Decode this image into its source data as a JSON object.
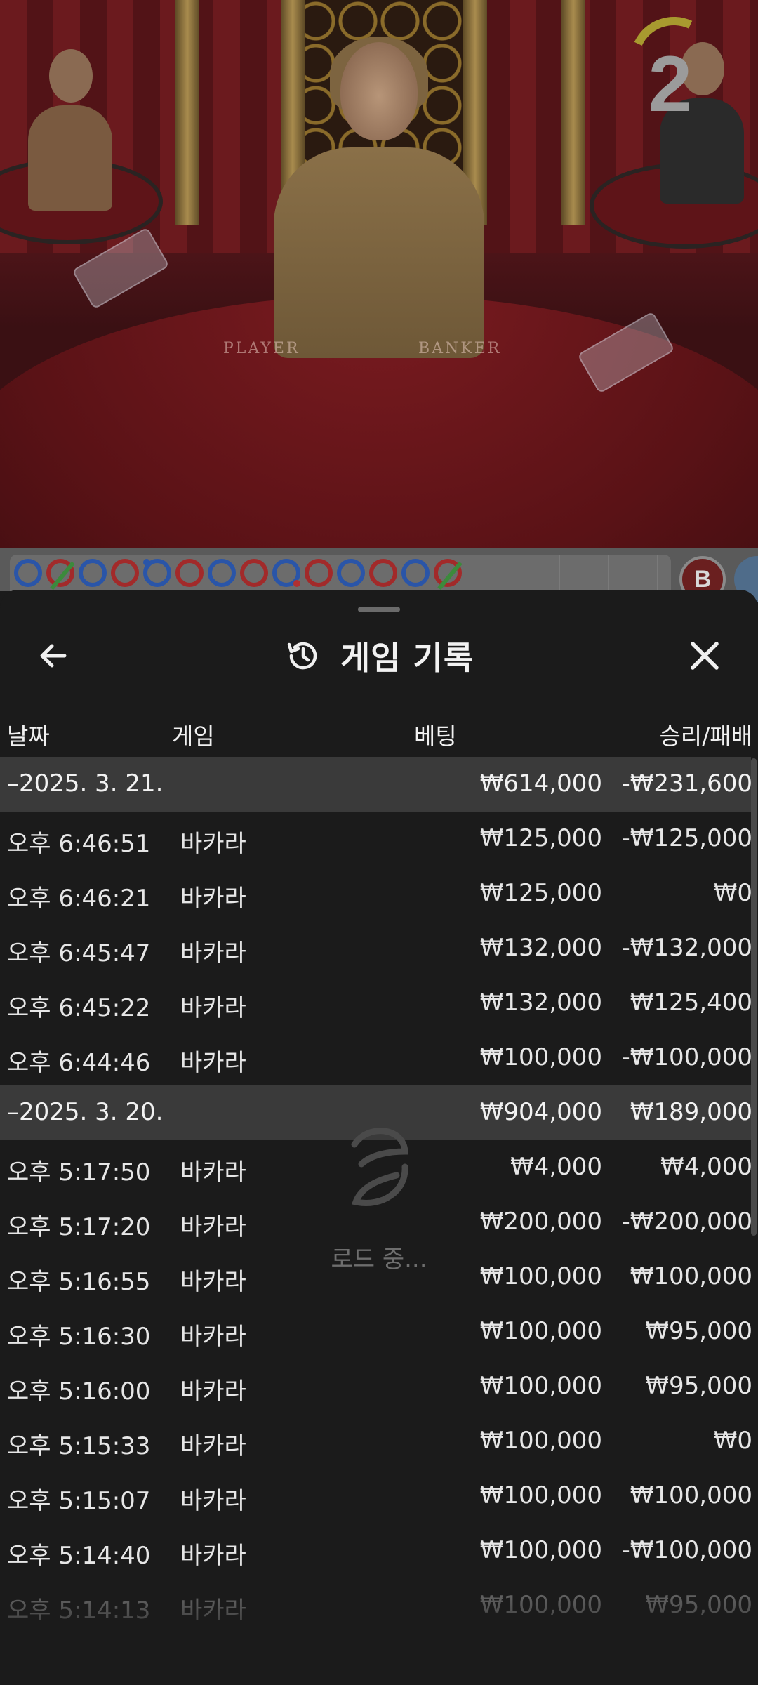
{
  "video": {
    "round_counter": "2",
    "felt_player": "PLAYER",
    "felt_banker": "BANKER"
  },
  "roadmap": {
    "beads": [
      {
        "color": "blue",
        "mark": ""
      },
      {
        "color": "red",
        "mark": "tie"
      },
      {
        "color": "blue",
        "mark": ""
      },
      {
        "color": "red",
        "mark": ""
      },
      {
        "color": "blue",
        "mark": "pair-dot-blue"
      },
      {
        "color": "red",
        "mark": ""
      },
      {
        "color": "blue",
        "mark": ""
      },
      {
        "color": "red",
        "mark": ""
      },
      {
        "color": "blue",
        "mark": "pair-dot"
      },
      {
        "color": "red",
        "mark": ""
      },
      {
        "color": "blue",
        "mark": ""
      },
      {
        "color": "red",
        "mark": ""
      },
      {
        "color": "blue",
        "mark": ""
      },
      {
        "color": "red",
        "mark": "tie"
      }
    ],
    "predict_label": "B"
  },
  "sheet": {
    "title": "게임 기록",
    "columns": {
      "date": "날짜",
      "game": "게임",
      "bet": "베팅",
      "result": "승리/패배"
    },
    "loading_text": "로드 중..."
  },
  "history": [
    {
      "type": "date",
      "time": "–2025. 3. 21.",
      "game": "",
      "bet": "₩614,000",
      "result": "-₩231,600"
    },
    {
      "type": "row",
      "time": "오후 6:46:51",
      "game": "바카라",
      "bet": "₩125,000",
      "result": "-₩125,000"
    },
    {
      "type": "row",
      "time": "오후 6:46:21",
      "game": "바카라",
      "bet": "₩125,000",
      "result": "₩0"
    },
    {
      "type": "row",
      "time": "오후 6:45:47",
      "game": "바카라",
      "bet": "₩132,000",
      "result": "-₩132,000"
    },
    {
      "type": "row",
      "time": "오후 6:45:22",
      "game": "바카라",
      "bet": "₩132,000",
      "result": "₩125,400"
    },
    {
      "type": "row",
      "time": "오후 6:44:46",
      "game": "바카라",
      "bet": "₩100,000",
      "result": "-₩100,000"
    },
    {
      "type": "date",
      "time": "–2025. 3. 20.",
      "game": "",
      "bet": "₩904,000",
      "result": "₩189,000"
    },
    {
      "type": "row",
      "time": "오후 5:17:50",
      "game": "바카라",
      "bet": "₩4,000",
      "result": "₩4,000"
    },
    {
      "type": "row",
      "time": "오후 5:17:20",
      "game": "바카라",
      "bet": "₩200,000",
      "result": "-₩200,000"
    },
    {
      "type": "row",
      "time": "오후 5:16:55",
      "game": "바카라",
      "bet": "₩100,000",
      "result": "₩100,000"
    },
    {
      "type": "row",
      "time": "오후 5:16:30",
      "game": "바카라",
      "bet": "₩100,000",
      "result": "₩95,000"
    },
    {
      "type": "row",
      "time": "오후 5:16:00",
      "game": "바카라",
      "bet": "₩100,000",
      "result": "₩95,000"
    },
    {
      "type": "row",
      "time": "오후 5:15:33",
      "game": "바카라",
      "bet": "₩100,000",
      "result": "₩0"
    },
    {
      "type": "row",
      "time": "오후 5:15:07",
      "game": "바카라",
      "bet": "₩100,000",
      "result": "₩100,000"
    },
    {
      "type": "row",
      "time": "오후 5:14:40",
      "game": "바카라",
      "bet": "₩100,000",
      "result": "-₩100,000"
    },
    {
      "type": "row",
      "time": "오후 5:14:13",
      "game": "바카라",
      "bet": "₩100,000",
      "result": "₩95,000"
    }
  ]
}
